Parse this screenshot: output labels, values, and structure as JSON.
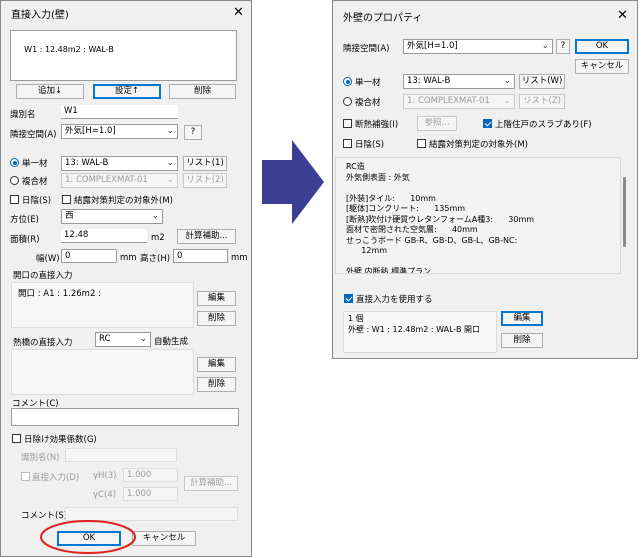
{
  "left": {
    "title": "直接入力(壁)",
    "close_glyph": "✕",
    "list_text": "W1 : 12.48m2 : WAL-B",
    "add_btn": "追加↓",
    "set_btn": "設定↑",
    "delete_btn": "削除",
    "id_label": "識別名",
    "id_value": "W1",
    "adjacent_label": "隣接空間(A)",
    "adjacent_value": "外気[H=1.0]",
    "help_btn": "?",
    "single_label": "単一材",
    "single_value": "13: WAL-B",
    "list1_btn": "リスト(1)",
    "composite_label": "複合材",
    "composite_value": "1: COMPLEXMAT-01",
    "list2_btn": "リスト(2)",
    "shade_label": "日陰(S)",
    "condensation_label": "結露対策判定の対象外(M)",
    "orientation_label": "方位(E)",
    "orientation_value": "西",
    "area_label": "面積(R)",
    "area_value": "12.48",
    "area_unit": "m2",
    "calc_btn": "計算補助...",
    "width_label": "幅(W)",
    "width_value": "0",
    "mm1": "mm",
    "height_label": "高さ(H)",
    "height_value": "0",
    "mm2": "mm",
    "opening_label": "開口の直接入力",
    "opening_text": "開口 : A1 : 1.26m2 :",
    "edit_btn1": "編集",
    "delete_btn1": "削除",
    "thermal_label": "熱橋の直接入力",
    "thermal_value": "RC",
    "autogen_label": "自動生成",
    "edit_btn2": "編集",
    "delete_btn2": "削除",
    "comment_label": "コメント(C)",
    "sunshade_label": "日除け効果係数(G)",
    "sun_id_label": "識別名(N)",
    "direct_input_label": "直接入力(D)",
    "yh_label": "γH(3)",
    "yh_value": "1.000",
    "yc_label": "γC(4)",
    "yc_value": "1.000",
    "calc_btn2": "計算補助...",
    "comment2_label": "コメント(S)",
    "ok_btn": "OK",
    "cancel_btn": "キャンセル"
  },
  "right": {
    "title": "外壁のプロパティ",
    "close_glyph": "✕",
    "adjacent_label": "隣接空間(A)",
    "adjacent_value": "外気[H=1.0]",
    "help_btn": "?",
    "ok_btn": "OK",
    "cancel_btn": "キャンセル",
    "single_label": "単一材",
    "single_value": "13: WAL-B",
    "list_btn": "リスト(W)",
    "composite_label": "複合材",
    "composite_value": "1: COMPLEXMAT-01",
    "list2_btn": "リスト(Z)",
    "insulation_label": "断熱補強(I)",
    "ref_btn": "参照...",
    "upper_slab_label": "上階住戸のスラブあり(F)",
    "shade_label": "日陰(S)",
    "condensation_label": "結露対策判定の対象外(M)",
    "info_lines": "RC造\n外気側表面 : 外気\n\n[外装]タイル:      10mm\n[躯体]コンクリート:      135mm\n[断熱]吹付け硬質ウレタンフォームA種3:      30mm\n面材で密閉された空気層:      40mm\nせっこうボード GB-R、GB-D、GB-L、GB-NC:\n      12mm\n\n外壁 内断熱 標準プラン",
    "direct_use_label": "直接入力を使用する",
    "direct_lines": "1 個\n外壁 : W1 : 12.48m2 : WAL-B 開口",
    "edit_btn": "編集",
    "delete_btn": "削除"
  },
  "arrow_color": "#3b3f94",
  "highlight_color": "#e02020"
}
